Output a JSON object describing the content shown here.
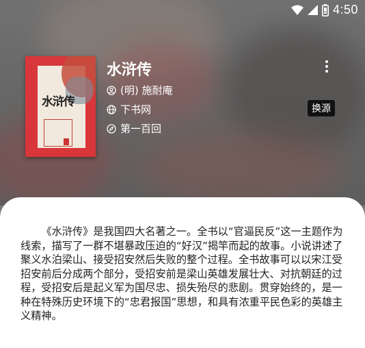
{
  "status_bar": {
    "time": "4:50",
    "icons": [
      "wifi-icon",
      "signal-icon",
      "battery-icon"
    ]
  },
  "book": {
    "title": "水浒传",
    "author": "(明) 施耐庵",
    "source": "下书网",
    "chapter": "第一百回",
    "cover_text": "水浒传",
    "switch_source_label": "换源",
    "intro": "《水浒传》是我国四大名著之一。全书以“官逼民反”这一主题作为线索，描写了一群不堪暴政压迫的“好汉”揭竿而起的故事。小说讲述了聚义水泊梁山、接受招安然后失败的整个过程。全书故事可以以宋江受招安前后分成两个部分，受招安前是梁山英雄发展壮大、对抗朝廷的过程，受招安后是起义军为国尽忠、损失殆尽的悲剧。贯穿始终的，是一种在特殊历史环境下的“忠君报国”思想，和具有浓重平民色彩的英雄主义精神。"
  },
  "colors": {
    "cover_red": "#d8363a",
    "sheet_bg": "#ffffff",
    "text": "#222222",
    "button_bg": "#111111"
  }
}
